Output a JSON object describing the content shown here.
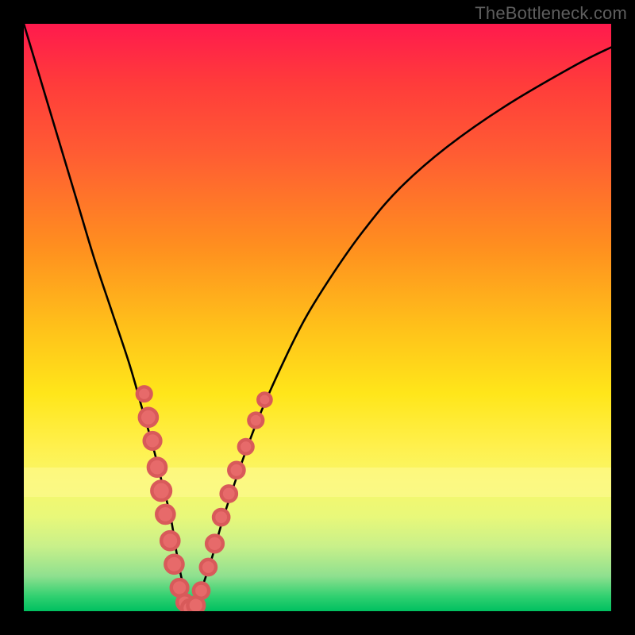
{
  "watermark": "TheBottleneck.com",
  "chart_data": {
    "type": "line",
    "title": "",
    "xlabel": "",
    "ylabel": "",
    "xlim": [
      0,
      100
    ],
    "ylim": [
      0,
      100
    ],
    "grid": false,
    "series": [
      {
        "name": "bottleneck-curve",
        "x": [
          0,
          3,
          6,
          9,
          12,
          15,
          18,
          20,
          22,
          23.5,
          25,
          26,
          27,
          28,
          29,
          30,
          32,
          34,
          37,
          40,
          44,
          48,
          53,
          58,
          64,
          72,
          82,
          94,
          100
        ],
        "y": [
          100,
          90,
          80,
          70,
          60,
          51,
          42,
          35,
          28,
          22,
          16,
          10,
          5,
          2,
          0,
          3,
          9,
          16,
          25,
          33,
          42,
          50,
          58,
          65,
          72,
          79,
          86,
          93,
          96
        ]
      }
    ],
    "markers": {
      "name": "data-points",
      "points": [
        {
          "x": 20.5,
          "y": 37.0,
          "r": 1.2
        },
        {
          "x": 21.2,
          "y": 33.0,
          "r": 1.5
        },
        {
          "x": 21.9,
          "y": 29.0,
          "r": 1.4
        },
        {
          "x": 22.7,
          "y": 24.5,
          "r": 1.5
        },
        {
          "x": 23.4,
          "y": 20.5,
          "r": 1.6
        },
        {
          "x": 24.1,
          "y": 16.5,
          "r": 1.5
        },
        {
          "x": 24.9,
          "y": 12.0,
          "r": 1.5
        },
        {
          "x": 25.6,
          "y": 8.0,
          "r": 1.5
        },
        {
          "x": 26.5,
          "y": 4.0,
          "r": 1.4
        },
        {
          "x": 27.4,
          "y": 1.5,
          "r": 1.3
        },
        {
          "x": 28.3,
          "y": 0.5,
          "r": 1.4
        },
        {
          "x": 29.3,
          "y": 1.0,
          "r": 1.4
        },
        {
          "x": 30.2,
          "y": 3.5,
          "r": 1.3
        },
        {
          "x": 31.4,
          "y": 7.5,
          "r": 1.3
        },
        {
          "x": 32.5,
          "y": 11.5,
          "r": 1.4
        },
        {
          "x": 33.6,
          "y": 16.0,
          "r": 1.3
        },
        {
          "x": 34.9,
          "y": 20.0,
          "r": 1.3
        },
        {
          "x": 36.2,
          "y": 24.0,
          "r": 1.3
        },
        {
          "x": 37.8,
          "y": 28.0,
          "r": 1.2
        },
        {
          "x": 39.5,
          "y": 32.5,
          "r": 1.2
        },
        {
          "x": 41.0,
          "y": 36.0,
          "r": 1.1
        }
      ]
    },
    "background_gradient": {
      "top_color": "#ff1a4d",
      "bottom_color": "#00c060"
    }
  }
}
